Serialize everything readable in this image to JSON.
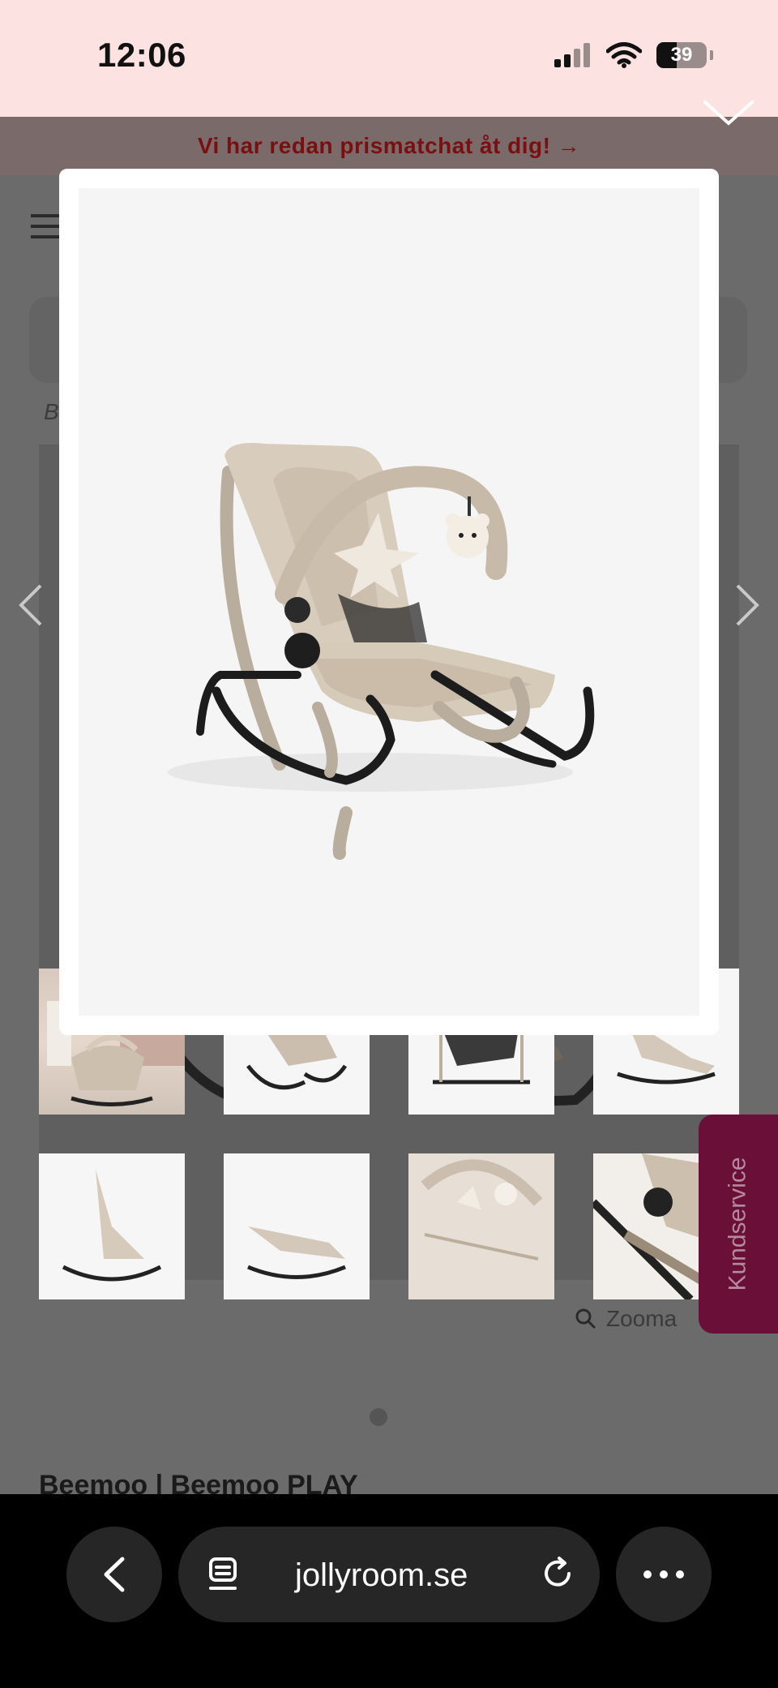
{
  "status_bar": {
    "time": "12:06",
    "battery": "39"
  },
  "promo": {
    "text": "Vi har redan prismatchat åt dig! →"
  },
  "page": {
    "breadcrumb_initial": "B",
    "zoom_label": "Zooma",
    "product_title": "Beemoo | Beemoo PLAY"
  },
  "kundservice": {
    "label": "Kundservice"
  },
  "modal": {
    "image_alt": "Beemoo PLAY babysitter i beige med leksaksbåge"
  },
  "browser": {
    "url": "jollyroom.se"
  },
  "colors": {
    "promo_text": "#7a0f12",
    "status_bg": "#fce3e1",
    "kundservice_bg": "#6a1038"
  }
}
